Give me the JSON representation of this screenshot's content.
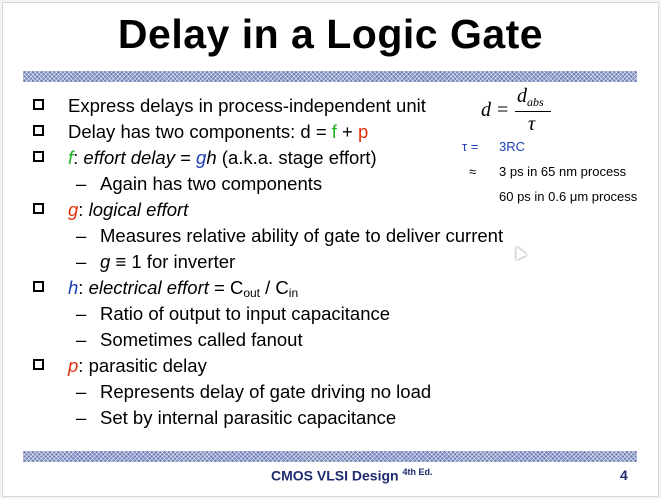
{
  "title": "Delay in a Logic Gate",
  "bullets": [
    {
      "level": 1,
      "text": "Express delays in process-independent unit"
    },
    {
      "level": 1,
      "parts": [
        "Delay has two components: d = ",
        "f",
        " + ",
        "p"
      ]
    },
    {
      "level": 1,
      "parts": [
        "f",
        ": ",
        "effort delay",
        " = ",
        "g",
        "h",
        " (a.k.a. stage effort)"
      ]
    },
    {
      "level": 2,
      "text": "Again has two components"
    },
    {
      "level": 1,
      "parts": [
        "g",
        ": ",
        "logical effort"
      ]
    },
    {
      "level": 2,
      "text": "Measures relative ability of gate to deliver current"
    },
    {
      "level": 2,
      "parts": [
        "g",
        " ≡ 1 for inverter"
      ]
    },
    {
      "level": 1,
      "parts": [
        "h",
        ": ",
        "electrical effort",
        " = C",
        "out",
        " / C",
        "in"
      ]
    },
    {
      "level": 2,
      "text": "Ratio of output to input capacitance"
    },
    {
      "level": 2,
      "text": "Sometimes called fanout"
    },
    {
      "level": 1,
      "parts": [
        "p",
        ": parasitic delay"
      ]
    },
    {
      "level": 2,
      "text": "Represents delay of gate driving no load"
    },
    {
      "level": 2,
      "text": "Set by internal parasitic capacitance"
    }
  ],
  "formula": {
    "lhs": "d",
    "eq": "=",
    "num": "d",
    "num_sub": "abs",
    "den": "τ"
  },
  "side_notes": {
    "tau_label": "τ =",
    "tau_value": "3RC",
    "approx": "≈",
    "ps_65": "3 ps in 65 nm process",
    "ps_06": "60 ps in 0.6 μm process"
  },
  "footer": {
    "text": "CMOS VLSI Design",
    "edition": "4th Ed.",
    "page": "4"
  },
  "colors": {
    "f": "#19b219",
    "p": "#e0300a",
    "g": "#1a3fb5",
    "band": "#6f7fb8",
    "footer": "#1f2b6f"
  }
}
